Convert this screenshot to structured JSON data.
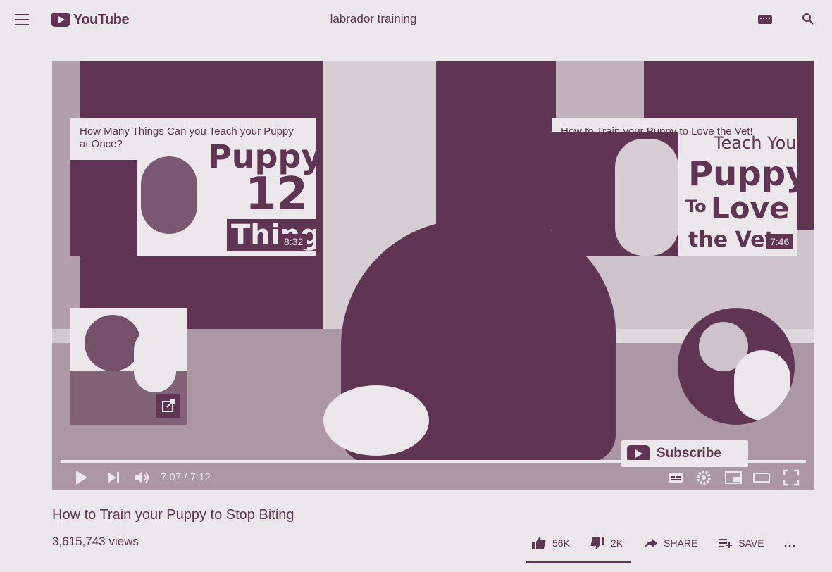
{
  "header": {
    "menu_icon": "hamburger-menu-icon",
    "logo_text": "YouTube",
    "search_query": "labrador training",
    "keyboard_icon": "keyboard-icon",
    "search_icon": "search-icon"
  },
  "player": {
    "cards": [
      {
        "title": "How Many Things Can you Teach your Puppy at Once?",
        "duration": "8:32",
        "thumb_text": [
          "Puppy",
          "12",
          "Things"
        ]
      },
      {
        "title": "How to Train your Puppy to Love the Vet!",
        "duration": "7:46",
        "thumb_text": [
          "Teach Your",
          "Puppy",
          "To",
          "Love",
          "the Vet"
        ]
      }
    ],
    "subscribe_label": "Subscribe",
    "progress": 0.99,
    "time_current": "7:07",
    "time_total": "7:12",
    "time_display": "7:07 / 7:12"
  },
  "video": {
    "title": "How to Train your Puppy to Stop Biting",
    "views": "3,615,743 views",
    "likes": "56K",
    "dislikes": "2K",
    "share_label": "SHARE",
    "save_label": "SAVE",
    "more_label": "..."
  },
  "colors": {
    "background": "#ebe7ea",
    "accent": "#5f3553"
  }
}
